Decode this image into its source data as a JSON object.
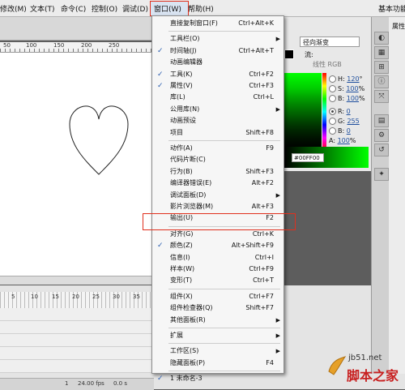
{
  "menubar": {
    "items": [
      "修改(M)",
      "文本(T)",
      "命令(C)",
      "控制(O)",
      "调试(D)",
      "窗口(W)",
      "帮助(H)"
    ],
    "essentials": "基本功能"
  },
  "ruler": {
    "ticks": [
      "50",
      "100",
      "150",
      "200",
      "250"
    ]
  },
  "timeline": {
    "frame_numbers": [
      "5",
      "10",
      "15",
      "20",
      "25",
      "30",
      "35"
    ],
    "status": {
      "frame": "1",
      "fps": "24.00 fps",
      "time": "0.0 s"
    }
  },
  "color_panel": {
    "fill_type": "径向渐变",
    "flow_label": "流:",
    "linear_rgb": "线性 RGB",
    "hex": "#00FF00",
    "hsb": [
      {
        "label": "H:",
        "value": "120",
        "unit": "°",
        "selected": false
      },
      {
        "label": "S:",
        "value": "100",
        "unit": "%",
        "selected": false
      },
      {
        "label": "B:",
        "value": "100",
        "unit": "%",
        "selected": false
      },
      {
        "label": "R:",
        "value": "0",
        "unit": "",
        "selected": true
      },
      {
        "label": "G:",
        "value": "255",
        "unit": "",
        "selected": false
      },
      {
        "label": "B:",
        "value": "0",
        "unit": "",
        "selected": false
      },
      {
        "label": "A:",
        "value": "100",
        "unit": "%",
        "selected": false
      }
    ]
  },
  "right_panel": {
    "properties_label": "属性"
  },
  "window_menu": {
    "items": [
      {
        "label": "直接复制窗口(F)",
        "shortcut": "Ctrl+Alt+K",
        "checked": false,
        "submenu": false
      },
      {
        "sep": true
      },
      {
        "label": "工具栏(O)",
        "shortcut": "",
        "checked": false,
        "submenu": true
      },
      {
        "label": "时间轴(J)",
        "shortcut": "Ctrl+Alt+T",
        "checked": true,
        "submenu": false
      },
      {
        "label": "动画编辑器",
        "shortcut": "",
        "checked": false,
        "submenu": false
      },
      {
        "label": "工具(K)",
        "shortcut": "Ctrl+F2",
        "checked": true,
        "submenu": false
      },
      {
        "label": "属性(V)",
        "shortcut": "Ctrl+F3",
        "checked": true,
        "submenu": false
      },
      {
        "label": "库(L)",
        "shortcut": "Ctrl+L",
        "checked": false,
        "submenu": false
      },
      {
        "label": "公用库(N)",
        "shortcut": "",
        "checked": false,
        "submenu": true
      },
      {
        "label": "动画预设",
        "shortcut": "",
        "checked": false,
        "submenu": false
      },
      {
        "label": "项目",
        "shortcut": "Shift+F8",
        "checked": false,
        "submenu": false
      },
      {
        "sep": true
      },
      {
        "label": "动作(A)",
        "shortcut": "F9",
        "checked": false,
        "submenu": false
      },
      {
        "label": "代码片断(C)",
        "shortcut": "",
        "checked": false,
        "submenu": false
      },
      {
        "label": "行为(B)",
        "shortcut": "Shift+F3",
        "checked": false,
        "submenu": false
      },
      {
        "label": "编译器错误(E)",
        "shortcut": "Alt+F2",
        "checked": false,
        "submenu": false
      },
      {
        "label": "调试面板(D)",
        "shortcut": "",
        "checked": false,
        "submenu": true
      },
      {
        "label": "影片浏览器(M)",
        "shortcut": "Alt+F3",
        "checked": false,
        "submenu": false
      },
      {
        "label": "输出(U)",
        "shortcut": "F2",
        "checked": false,
        "submenu": false
      },
      {
        "sep": true
      },
      {
        "label": "对齐(G)",
        "shortcut": "Ctrl+K",
        "checked": false,
        "submenu": false
      },
      {
        "label": "颜色(Z)",
        "shortcut": "Alt+Shift+F9",
        "checked": true,
        "submenu": false
      },
      {
        "label": "信息(I)",
        "shortcut": "Ctrl+I",
        "checked": false,
        "submenu": false
      },
      {
        "label": "样本(W)",
        "shortcut": "Ctrl+F9",
        "checked": false,
        "submenu": false
      },
      {
        "label": "变形(T)",
        "shortcut": "Ctrl+T",
        "checked": false,
        "submenu": false
      },
      {
        "sep": true
      },
      {
        "label": "组件(X)",
        "shortcut": "Ctrl+F7",
        "checked": false,
        "submenu": false
      },
      {
        "label": "组件检查器(Q)",
        "shortcut": "Shift+F7",
        "checked": false,
        "submenu": false
      },
      {
        "label": "其他面板(R)",
        "shortcut": "",
        "checked": false,
        "submenu": true
      },
      {
        "sep": true
      },
      {
        "label": "扩展",
        "shortcut": "",
        "checked": false,
        "submenu": true
      },
      {
        "sep": true
      },
      {
        "label": "工作区(S)",
        "shortcut": "",
        "checked": false,
        "submenu": true
      },
      {
        "label": "隐藏面板(P)",
        "shortcut": "F4",
        "checked": false,
        "submenu": false
      },
      {
        "sep": true
      },
      {
        "label": "1 未命名-3",
        "shortcut": "",
        "checked": true,
        "submenu": false
      }
    ]
  },
  "watermark": {
    "site": "jb51.net",
    "brand": "脚本之家"
  },
  "colors": {
    "highlight_box": "#e0301e",
    "spectrum_color": "#00ff00"
  }
}
